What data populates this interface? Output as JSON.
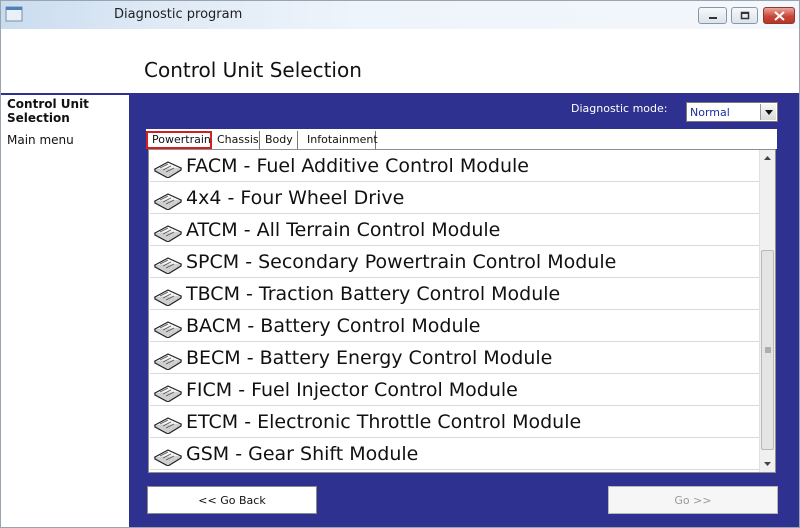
{
  "window": {
    "title": "Diagnostic program"
  },
  "header": {
    "page_title": "Control Unit Selection"
  },
  "sidebar": {
    "active_item": "Control Unit Selection",
    "menu_item": "Main menu"
  },
  "diagnostic_mode": {
    "label": "Diagnostic mode:",
    "value": "Normal"
  },
  "tabs": [
    {
      "label": "Powertrain",
      "active": true
    },
    {
      "label": "Chassis"
    },
    {
      "label": "Body"
    },
    {
      "label": "Infotainment"
    }
  ],
  "modules": [
    "FACM - Fuel Additive Control Module",
    "4x4 - Four Wheel Drive",
    "ATCM - All Terrain Control Module",
    "SPCM - Secondary Powertrain Control Module",
    "TBCM - Traction Battery Control Module",
    "BACM - Battery Control Module",
    "BECM - Battery Energy Control Module",
    "FICM - Fuel Injector Control Module",
    "ETCM - Electronic Throttle Control Module",
    "GSM - Gear Shift Module"
  ],
  "buttons": {
    "back": "<< Go Back",
    "go": "Go >>"
  },
  "icons": {
    "module_icon": "control-unit-icon",
    "app_icon": "app-icon"
  },
  "colors": {
    "panel_bg": "#2f3190",
    "tab_highlight": "#d02020"
  }
}
